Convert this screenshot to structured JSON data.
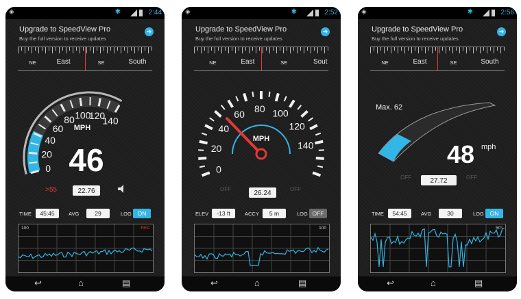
{
  "phones": [
    {
      "status_time": "2:44",
      "header": {
        "title": "Upgrade to SpeedView Pro",
        "subtitle": "Buy the full version to receive updates"
      },
      "compass": [
        {
          "t": "NE",
          "s": true,
          "x": 11
        },
        {
          "t": "East",
          "s": false,
          "x": 34
        },
        {
          "t": "SE",
          "s": true,
          "x": 62
        },
        {
          "t": "South",
          "s": false,
          "x": 89
        }
      ],
      "gauge": {
        "unit": "MPH",
        "speed": "46",
        "ticks": [
          "0",
          "20",
          "40",
          "60",
          "80",
          "100",
          "120",
          "140"
        ],
        "limit": ">55",
        "trip": "22.76",
        "fill_fraction": 0.3
      },
      "controls": [
        {
          "key": "TIME",
          "value": "45:45",
          "kind": "box"
        },
        {
          "key": "AVG",
          "value": "29",
          "kind": "box"
        },
        {
          "key": "LOG",
          "value": "ON",
          "kind": "on"
        }
      ],
      "graph": {
        "left": "100",
        "right": "REC",
        "right_color": "#e53935"
      }
    },
    {
      "status_time": "2:52",
      "header": {
        "title": "Upgrade to SpeedView Pro",
        "subtitle": "Buy the full version to receive updates"
      },
      "compass": [
        {
          "t": "NE",
          "s": true,
          "x": 14
        },
        {
          "t": "East",
          "s": false,
          "x": 40
        },
        {
          "t": "SE",
          "s": true,
          "x": 67
        },
        {
          "t": "Sout",
          "s": false,
          "x": 94
        }
      ],
      "gauge": {
        "unit": "MPH",
        "ticks": [
          "0",
          "20",
          "40",
          "60",
          "80",
          "100",
          "120",
          "140"
        ],
        "off_left": "OFF",
        "off_right": "OFF",
        "trip": "26.24",
        "needle_fraction": 0.3
      },
      "controls": [
        {
          "key": "ELEV",
          "value": "-13 ft",
          "kind": "box"
        },
        {
          "key": "ACCY",
          "value": "5 m",
          "kind": "box"
        },
        {
          "key": "LOG",
          "value": "OFF",
          "kind": "off"
        }
      ],
      "graph": {
        "left": "",
        "right": "100",
        "right_color": "#d8d8d8"
      }
    },
    {
      "status_time": "2:56",
      "header": {
        "title": "Upgrade to SpeedView Pro",
        "subtitle": "Buy the full version to receive updates"
      },
      "compass": [
        {
          "t": "NE",
          "s": true,
          "x": 11
        },
        {
          "t": "East",
          "s": false,
          "x": 37
        },
        {
          "t": "SE",
          "s": true,
          "x": 62
        },
        {
          "t": "South",
          "s": false,
          "x": 89
        }
      ],
      "gauge": {
        "max_label": "Max. 62",
        "speed": "48",
        "unit": "mph",
        "off_left": "OFF",
        "off_right": "OFF",
        "trip": "27.72",
        "fill_fraction": 0.2
      },
      "controls": [
        {
          "key": "TIME",
          "value": "54:45",
          "kind": "box"
        },
        {
          "key": "AVG",
          "value": "30",
          "kind": "box"
        },
        {
          "key": "LOG",
          "value": "ON",
          "kind": "on"
        }
      ],
      "graph": {
        "left": "",
        "right": "50°",
        "right_color": "#d8d8d8"
      }
    }
  ]
}
